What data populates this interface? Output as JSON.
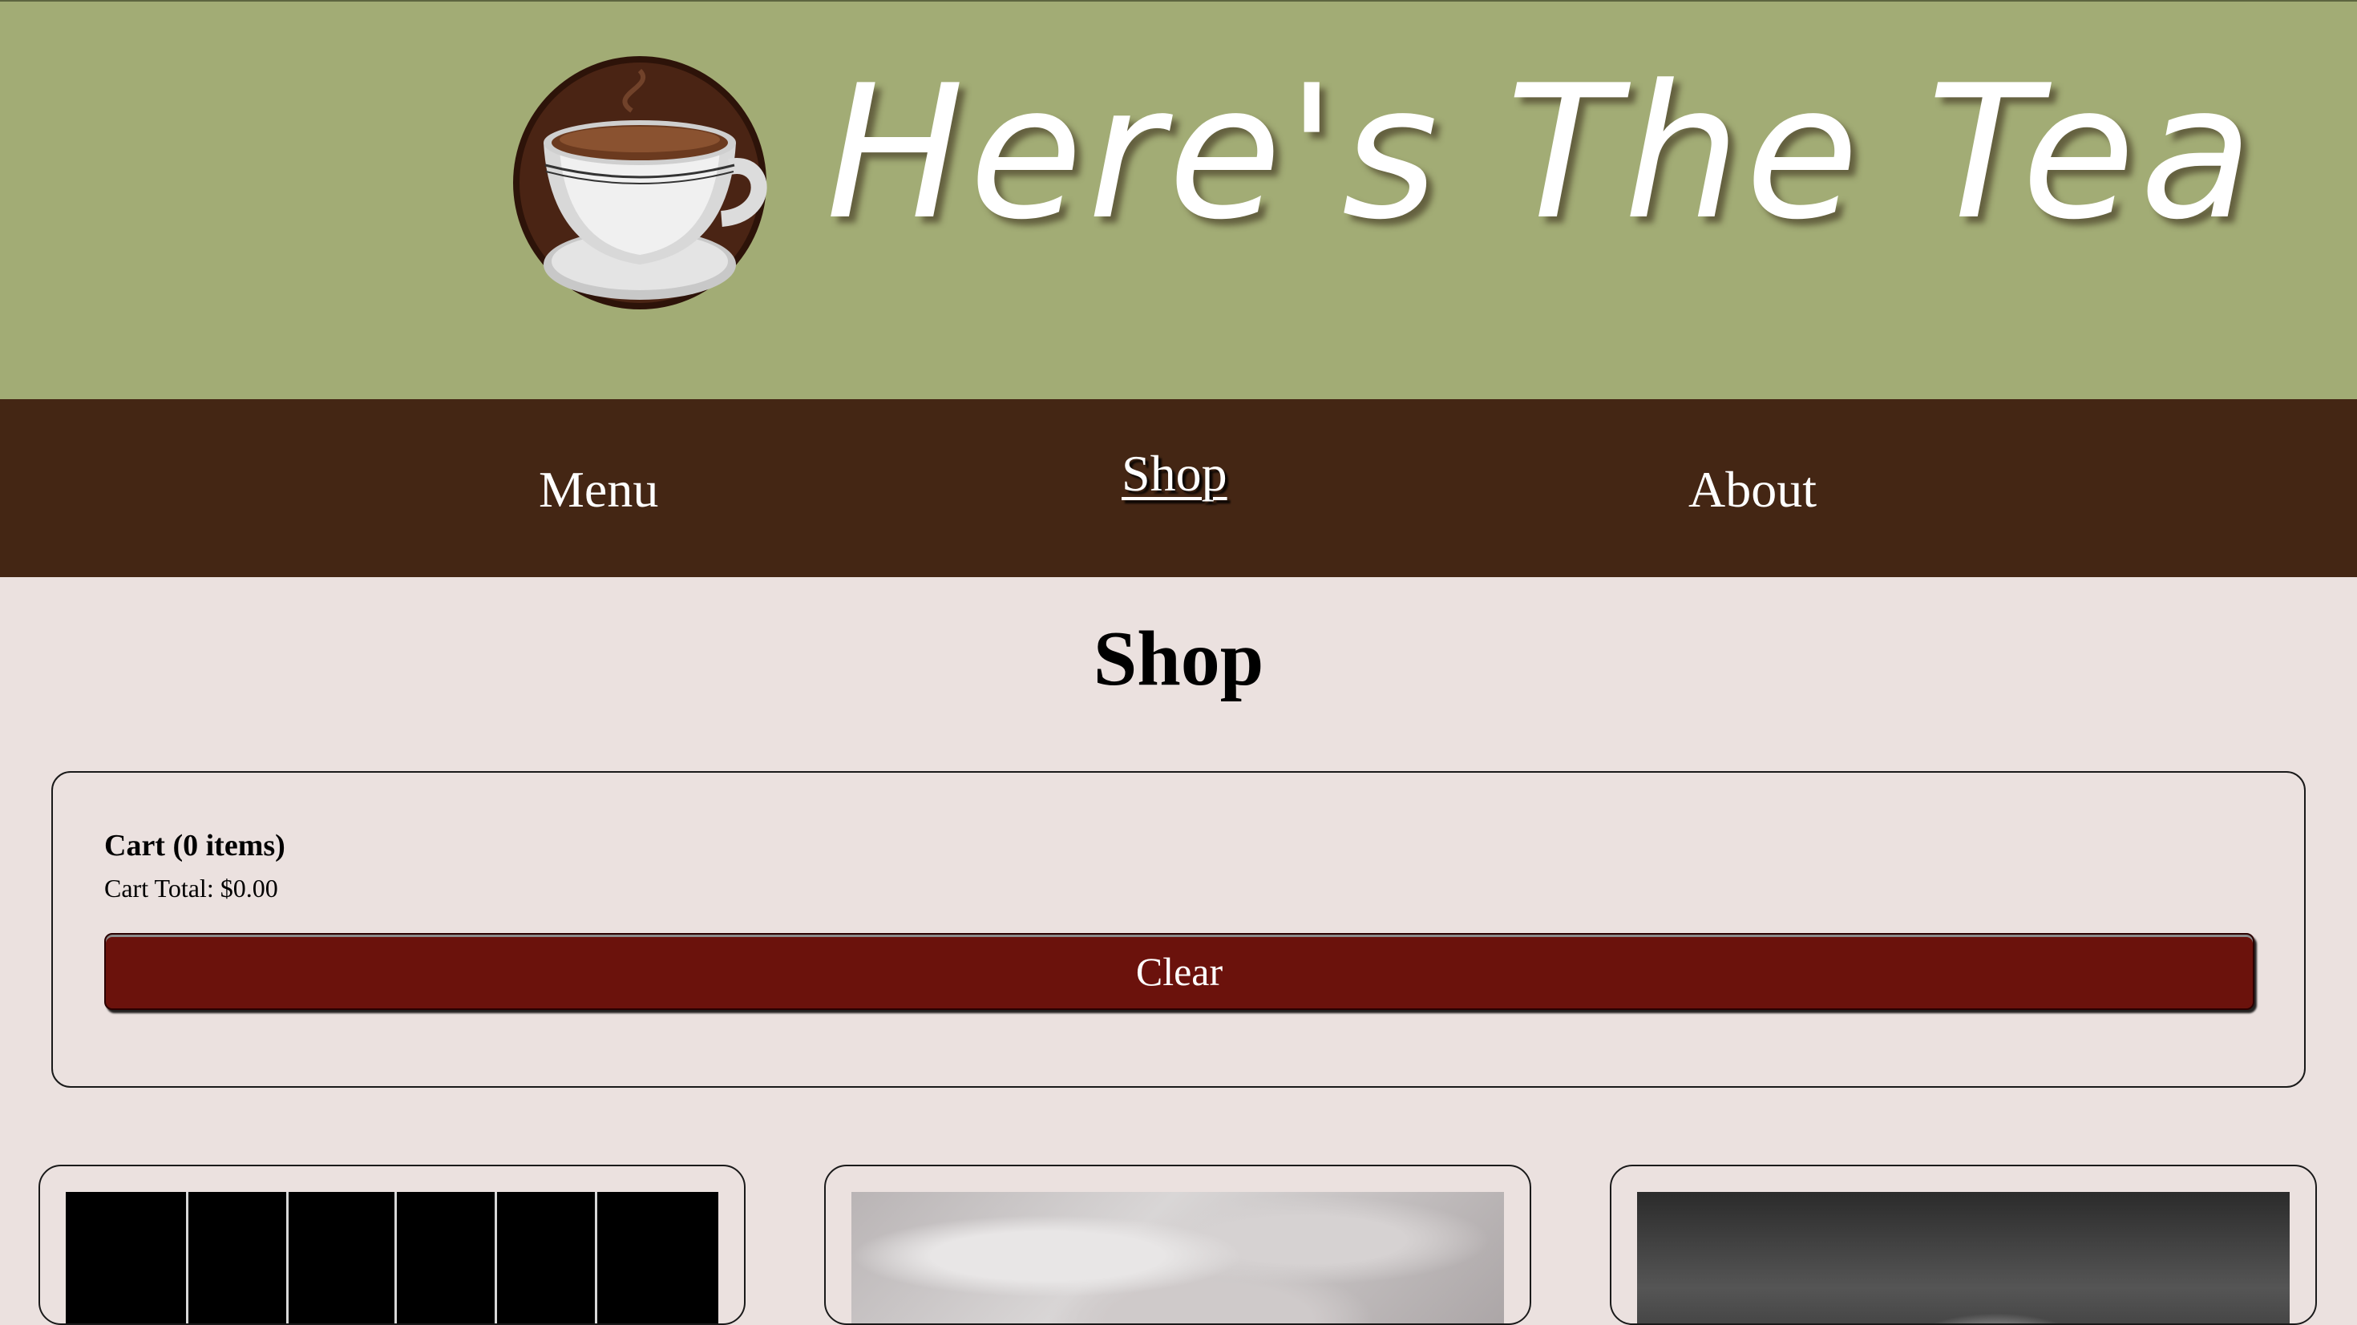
{
  "header": {
    "brand_title": "Here's The Tea",
    "logo_icon": "coffee-cup-icon"
  },
  "nav": {
    "items": [
      {
        "label": "Menu",
        "active": false
      },
      {
        "label": "Shop",
        "active": true
      },
      {
        "label": "About",
        "active": false
      }
    ]
  },
  "main": {
    "page_title": "Shop"
  },
  "cart": {
    "title": "Cart (0 items)",
    "total": "Cart Total: $0.00",
    "clear_label": "Clear"
  },
  "colors": {
    "header_bg": "#a2ac75",
    "nav_bg": "#442614",
    "page_bg": "#ebe1df",
    "clear_button_bg": "#6b120c"
  },
  "products": [
    {
      "image": "black-striped-product-image"
    },
    {
      "image": "tea-bags-product-image"
    },
    {
      "image": "dark-product-image"
    }
  ]
}
